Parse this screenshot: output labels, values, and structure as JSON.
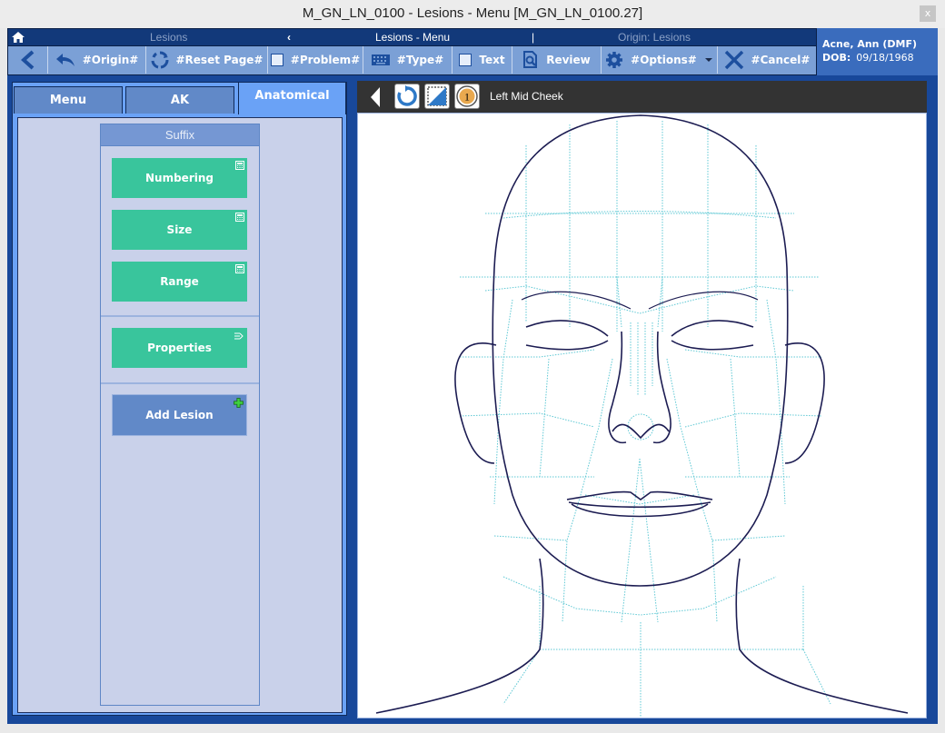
{
  "window": {
    "title": "M_GN_LN_0100 - Lesions - Menu [M_GN_LN_0100.27]",
    "close_label": "x"
  },
  "nav": {
    "home_icon": "home-icon",
    "left_label": "Lesions",
    "back_chevron": "‹",
    "center_label": "Lesions - Menu",
    "divider": "|",
    "right_label": "Origin: Lesions"
  },
  "toolbar": {
    "back_icon": "chevron-left-icon",
    "buttons": [
      {
        "label": "#Origin#",
        "icon": "undo-arrow-icon"
      },
      {
        "label": "#Reset Page#",
        "icon": "refresh-icon"
      },
      {
        "label": "#Problem#",
        "icon": "checkbox-icon"
      },
      {
        "label": "#Type#",
        "icon": "keyboard-icon"
      },
      {
        "label": "Text",
        "icon": "checkbox-icon"
      },
      {
        "label": "Review",
        "icon": "document-search-icon"
      },
      {
        "label": "#Options#",
        "icon": "gear-icon"
      },
      {
        "label": "#Cancel#",
        "icon": "close-x-icon"
      }
    ]
  },
  "patient": {
    "name": "Acne, Ann (DMF)",
    "dob_label": "DOB:",
    "dob": "09/18/1968"
  },
  "tabs": [
    {
      "label": "Menu",
      "active": false
    },
    {
      "label": "AK",
      "active": false
    },
    {
      "label": "Anatomical",
      "active": true
    }
  ],
  "suffix": {
    "header": "Suffix",
    "buttons": [
      {
        "label": "Numbering",
        "icon": "calculator-icon"
      },
      {
        "label": "Size",
        "icon": "calculator-icon"
      },
      {
        "label": "Range",
        "icon": "calculator-icon"
      },
      {
        "label": "Properties",
        "icon": "arrow-right-lines-icon"
      },
      {
        "label": "Add Lesion",
        "icon": "green-plus-icon"
      }
    ]
  },
  "viewer": {
    "location": "Left Mid Cheek",
    "badge_number": "1",
    "colors": {
      "outline": "#1c1c52",
      "grid": "#5ec8d4"
    }
  }
}
